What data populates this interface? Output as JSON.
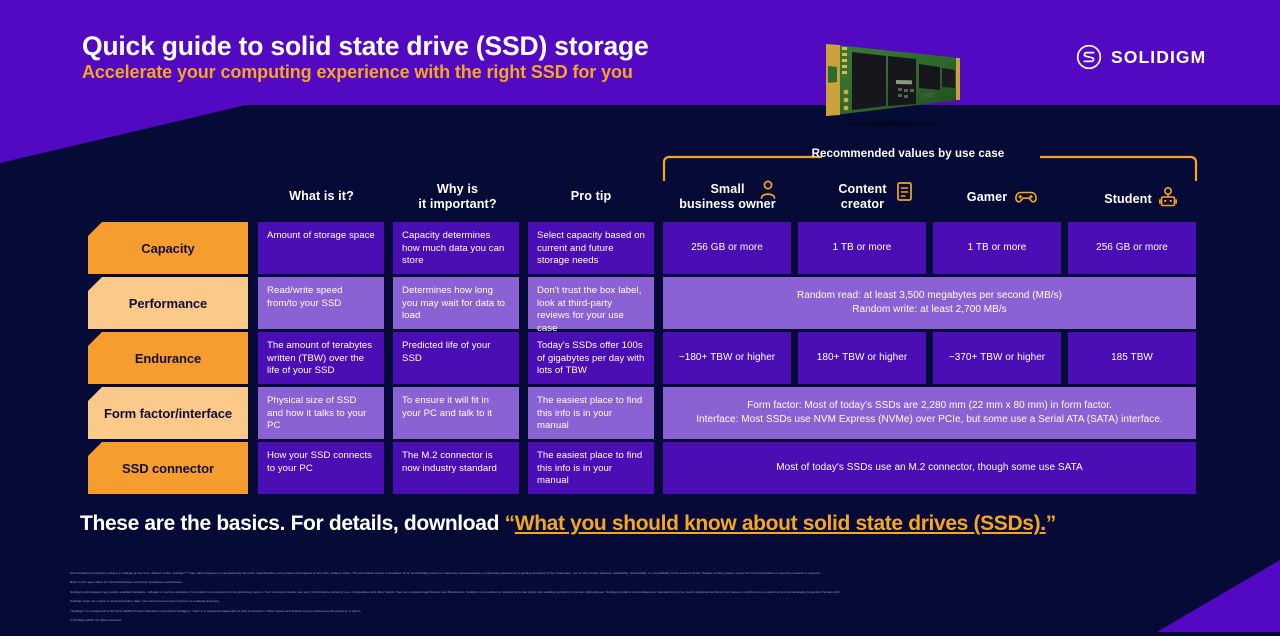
{
  "header": {
    "title": "Quick guide to solid state drive (SSD) storage",
    "subtitle": "Accelerate your computing experience with the right SSD for you",
    "logo_text": "SOLIDIGM",
    "logo_tm": ".",
    "product_image": "ssd-m2-module-image"
  },
  "use_case_bracket": {
    "label": "Recommended values by use case"
  },
  "columns": [
    {
      "id": "attribute",
      "label": ""
    },
    {
      "id": "what",
      "label": "What is it?",
      "icon": null
    },
    {
      "id": "why",
      "label": "Why is\nit important?",
      "icon": null
    },
    {
      "id": "protip",
      "label": "Pro tip",
      "icon": null
    },
    {
      "id": "smb",
      "label": "Small\nbusiness owner",
      "icon": "person-icon"
    },
    {
      "id": "creator",
      "label": "Content\ncreator",
      "icon": "document-icon"
    },
    {
      "id": "gamer",
      "label": "Gamer",
      "icon": "gamepad-icon"
    },
    {
      "id": "student",
      "label": "Student",
      "icon": "student-icon"
    }
  ],
  "column_labels": {
    "what": "What is it?",
    "why_line1": "Why is",
    "why_line2": "it important?",
    "protip": "Pro tip",
    "smb_line1": "Small",
    "smb_line2": "business owner",
    "creator_line1": "Content",
    "creator_line2": "creator",
    "gamer": "Gamer",
    "student": "Student"
  },
  "rows": [
    {
      "label": "Capacity",
      "what": "Amount of storage space",
      "why": "Capacity determines how much data you can store",
      "protip": "Select capacity based on current and future storage needs",
      "span": false,
      "smb": "256 GB or more",
      "creator": "1 TB or more",
      "gamer": "1 TB or more",
      "student": "256 GB or more"
    },
    {
      "label": "Performance",
      "what": "Read/write speed from/to your SSD",
      "why": "Determines how long you may wait for data to load",
      "protip": "Don't trust the box label, look at third-party reviews for your use case",
      "span": true,
      "span_line1": "Random read: at least 3,500 megabytes per second (MB/s)",
      "span_line2": "Random write: at least 2,700 MB/s"
    },
    {
      "label": "Endurance",
      "what": "The amount of terabytes written (TBW) over the life of your SSD",
      "why": "Predicted life of your SSD",
      "protip": "Today's SSDs offer 100s of gigabytes per day with lots of TBW",
      "span": false,
      "smb": "~180+ TBW or higher",
      "creator": "180+ TBW or higher",
      "gamer": "~370+ TBW or higher",
      "student": "185 TBW"
    },
    {
      "label": "Form factor/interface",
      "what": "Physical size of SSD and how it talks to your PC",
      "why": "To ensure it will fit in your PC and talk to it",
      "protip": "The easiest place to find this info is in your manual",
      "span": true,
      "span_line1": "Form factor: Most of today's SSDs are 2,280 mm (22 mm x 80 mm) in form factor.",
      "span_line2": "Interface: Most SSDs use NVM Express (NVMe) over PCIe, but some use a Serial ATA (SATA) interface."
    },
    {
      "label": "SSD connector",
      "what": "How your SSD connects to your PC",
      "why": "The M.2 connector is now industry standard",
      "protip": "The easiest place to find this info is in your manual",
      "span": true,
      "span_line1": "Most of today's SSDs use an M.2 connector, though some use SATA",
      "span_line2": ""
    }
  ],
  "cta": {
    "prefix": "These are the basics. For details, download ",
    "open_quote": "“",
    "link": "What you should know about solid state drives (SSDs).",
    "close_quote": "”"
  },
  "legal": {
    "p1": "All information provided is subject to change at any time, without notice. Solidigm™ may make changes to manufacturing life cycle, specifications, and product descriptions at any time, without notice. The information herein is provided “as is” and Solidigm does not make any representations or warranties whatsoever regarding accuracy of the information, nor on the product features, availability, functionality, or compatibility of the products listed. Please contact system vendor for more information on specific products or systems.",
    "p2": "Refer to the spec sheet for formal definitions of product properties and features.",
    "p3": "Solidigm technologies may require enabled hardware, software or service activation. No product or component can be absolutely secure. Your costs and results may vary. Performance varies by use, configuration and other factors. See our complete legal Notices and Disclaimers. Solidigm is committed to respecting human rights and avoiding complicity in human rights abuses. Solidigm products and software are intended only to be used in applications that do not cause or contribute to a violation of an internationally recognized human right.",
    "p4": "Solidigm does not control or audit third-party data. You should consult other sources to evaluate accuracy.",
    "p5": "“Solidigm” is a trademark of SK hynix NAND Product Solutions Corp (d/b/a Solidigm). “Intel” is a registered trademark of Intel Corporation. Other names and brands may be claimed as the property of others.",
    "p6": "© Solidigm 2022. All rights reserved."
  },
  "colors": {
    "header_purple": "#5209C1",
    "body_navy": "#050B36",
    "accent_orange": "#F5A623",
    "label_orange_dark": "#F79C2E",
    "label_orange_light": "#FBC98A",
    "cell_purple_dark": "#4B0EB5",
    "cell_purple_light": "#8B62D4"
  }
}
